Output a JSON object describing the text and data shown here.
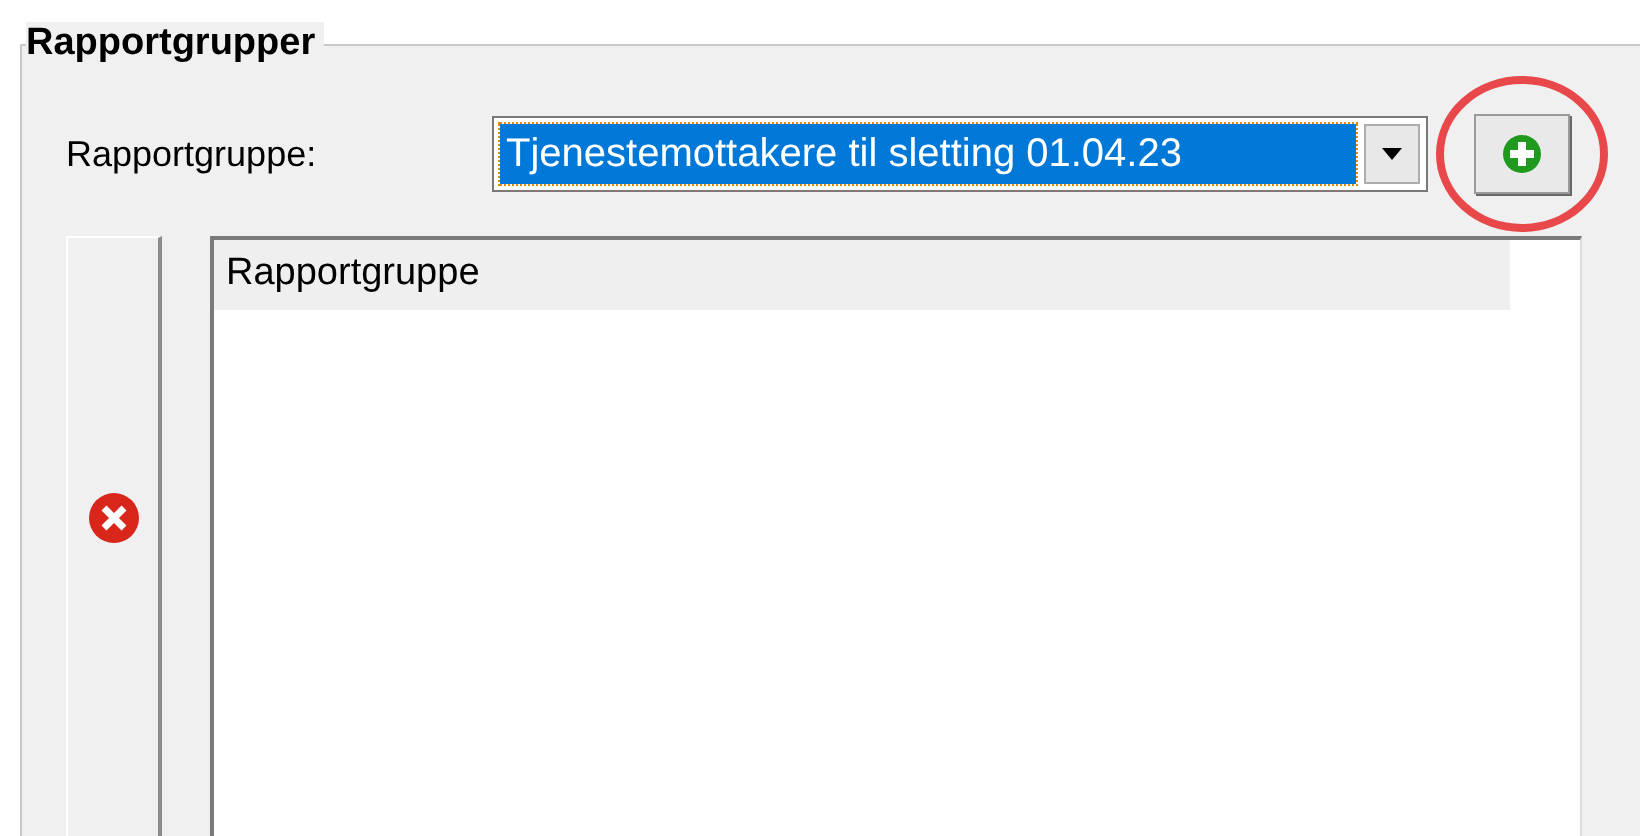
{
  "group": {
    "title": "Rapportgrupper"
  },
  "field": {
    "label": "Rapportgruppe:",
    "value": "Tjenestemottakere til sletting 01.04.23",
    "focused": true
  },
  "add_button": {
    "highlighted": true
  },
  "list": {
    "columns": [
      "Rapportgruppe"
    ]
  }
}
